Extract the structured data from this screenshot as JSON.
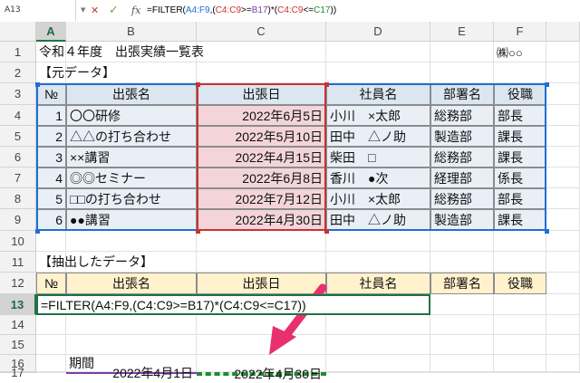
{
  "formula_bar": {
    "name_box": "A13",
    "cancel_icon": "✕",
    "enter_icon": "✓",
    "fx_label": "fx",
    "formula_parts": [
      "=FILTER(",
      "A4:F9",
      ",(",
      "C4:C9",
      ">=",
      "B17",
      ")*(",
      "C4:C9",
      "<=",
      "C17",
      "))"
    ]
  },
  "column_headers": [
    "A",
    "B",
    "C",
    "D",
    "E",
    "F"
  ],
  "row_headers": [
    "1",
    "2",
    "3",
    "4",
    "5",
    "6",
    "7",
    "8",
    "9",
    "10",
    "11",
    "12",
    "13",
    "14",
    "15",
    "16",
    "17"
  ],
  "sheet": {
    "title": "令和４年度　出張実績一覧表",
    "company": "㈱○○",
    "source_label": "【元データ】",
    "table_headers": [
      "№",
      "出張名",
      "出張日",
      "社員名",
      "部署名",
      "役職"
    ],
    "rows": [
      [
        "1",
        "〇〇研修",
        "2022年6月5日",
        "小川　×太郎",
        "総務部",
        "部長"
      ],
      [
        "2",
        "△△の打ち合わせ",
        "2022年5月10日",
        "田中　△ノ助",
        "製造部",
        "課長"
      ],
      [
        "3",
        "××講習",
        "2022年4月15日",
        "柴田　□",
        "総務部",
        "課長"
      ],
      [
        "4",
        "◎◎セミナー",
        "2022年6月8日",
        "香川　●次",
        "経理部",
        "係長"
      ],
      [
        "5",
        "□□の打ち合わせ",
        "2022年7月12日",
        "小川　×太郎",
        "総務部",
        "部長"
      ],
      [
        "6",
        "●●講習",
        "2022年4月30日",
        "田中　△ノ助",
        "製造部",
        "課長"
      ]
    ],
    "extract_label": "【抽出したデータ】",
    "extract_headers": [
      "№",
      "出張名",
      "出張日",
      "社員名",
      "部署名",
      "役職"
    ],
    "edit_formula": "=FILTER(A4:F9,(C4:C9>=B17)*(C4:C9<=C17))",
    "period_label": "期間",
    "start_date": "2022年4月1日",
    "end_date": "2022年4月30日"
  },
  "colors": {
    "accent": "#217346",
    "arrow": "#e8306e",
    "ref_blue": "#1f6fd3",
    "ref_red": "#c83232",
    "ref_green": "#1f8a34"
  }
}
